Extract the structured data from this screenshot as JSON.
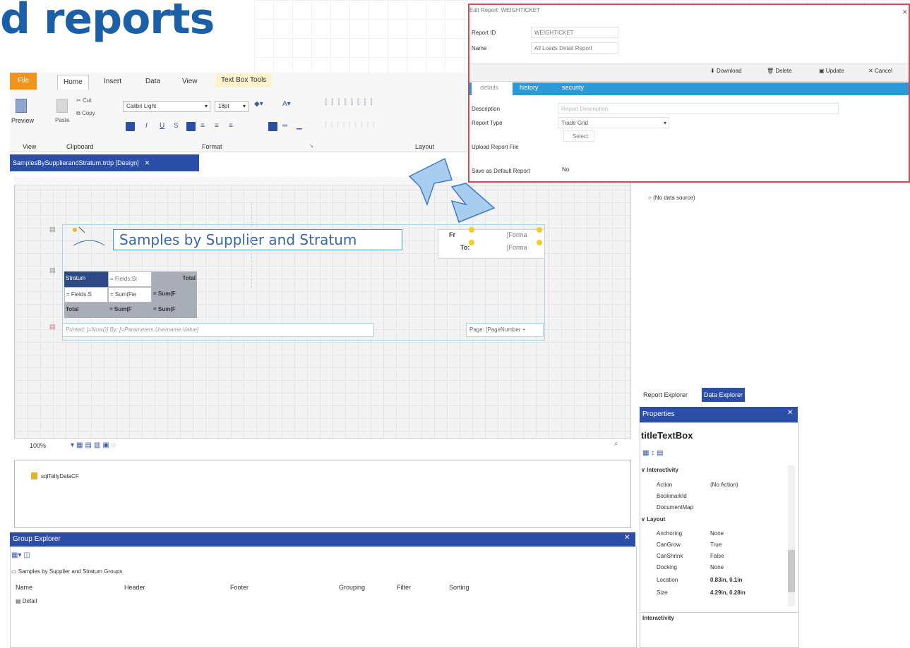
{
  "heading": "d reports",
  "ribbon": {
    "tabs": {
      "file": "File",
      "home": "Home",
      "insert": "Insert",
      "data": "Data",
      "view": "View",
      "tools": "Text Box Tools"
    },
    "preview": "Preview",
    "paste": "Paste",
    "cut": "Cut",
    "copy": "Copy",
    "font_name": "Calibri Light",
    "font_size": "18pt",
    "groups": {
      "view": "View",
      "clipboard": "Clipboard",
      "format": "Format",
      "layout": "Layout"
    }
  },
  "doc_tab": {
    "label": "SamplesBySupplierandStratum.trdp [Design]",
    "close": "✕"
  },
  "designer": {
    "title": "Samples by Supplier and Stratum",
    "fr_label": "Fr",
    "to_label": "To:",
    "fr_value": "[Forma",
    "to_value": "[Forma",
    "crosstab": {
      "stratum": "Stratum",
      "fields_s": "= Fields.St",
      "total": "Total",
      "fields_row": "= Fields.S",
      "sum_fie": "= Sum(Fie",
      "sum_f": "= Sum(F",
      "total_row": "Total",
      "sum_f2": "= Sum(F",
      "sum_f3": "= Sum(F"
    },
    "printed": "Printed: [=Now()] By: [=Parameters.Username.Value]",
    "page": "Page: [PageNumber +"
  },
  "zoom": "100%",
  "data_source": "sqlTallyDataCF",
  "group_explorer": {
    "title": "Group Explorer",
    "close": "✕",
    "group_name": "Samples by Supplier and Stratum Groups",
    "columns": [
      "Name",
      "Header",
      "Footer",
      "Grouping",
      "Filter",
      "Sorting"
    ],
    "detail": "Detail"
  },
  "right_panel": {
    "no_data_source": "(No data source)",
    "report_explorer": "Report Explorer",
    "data_explorer": "Data Explorer",
    "properties": "Properties",
    "properties_close": "✕",
    "selected": "titleTextBox",
    "sections": {
      "interactivity": "Interactivity",
      "layout": "Layout"
    },
    "props": [
      {
        "name": "Action",
        "value": "(No Action)"
      },
      {
        "name": "BookmarkId",
        "value": ""
      },
      {
        "name": "DocumentMap",
        "value": ""
      },
      {
        "name": "Anchoring",
        "value": "None"
      },
      {
        "name": "CanGrow",
        "value": "True"
      },
      {
        "name": "CanShrink",
        "value": "False"
      },
      {
        "name": "Docking",
        "value": "None"
      },
      {
        "name": "Location",
        "value": "0.83in, 0.1in"
      },
      {
        "name": "Size",
        "value": "4.29in, 0.28in"
      }
    ],
    "description_title": "Interactivity"
  },
  "dialog": {
    "title": "Edit Report: WEIGHTICKET",
    "close": "✕",
    "report_id_label": "Report ID",
    "report_id": "WEIGHTICKET",
    "name_label": "Name",
    "name": "All Loads Detail Report",
    "buttons": {
      "download": "Download",
      "delete": "Delete",
      "update": "Update",
      "cancel": "Cancel"
    },
    "tabs": {
      "details": "details",
      "history": "history",
      "security": "security"
    },
    "description_label": "Description",
    "description_placeholder": "Report Description",
    "report_type_label": "Report Type",
    "report_type": "Trade Grid",
    "select_btn": "Select",
    "upload_label": "Upload Report File",
    "default_label": "Save as Default Report",
    "default_value": "No"
  },
  "colors": {
    "accent": "#2b4ea7",
    "heading": "#1a5fa8",
    "file_tab": "#f0941e",
    "dialog_border": "#d34a55",
    "dialog_tabs": "#2b9bd8"
  }
}
